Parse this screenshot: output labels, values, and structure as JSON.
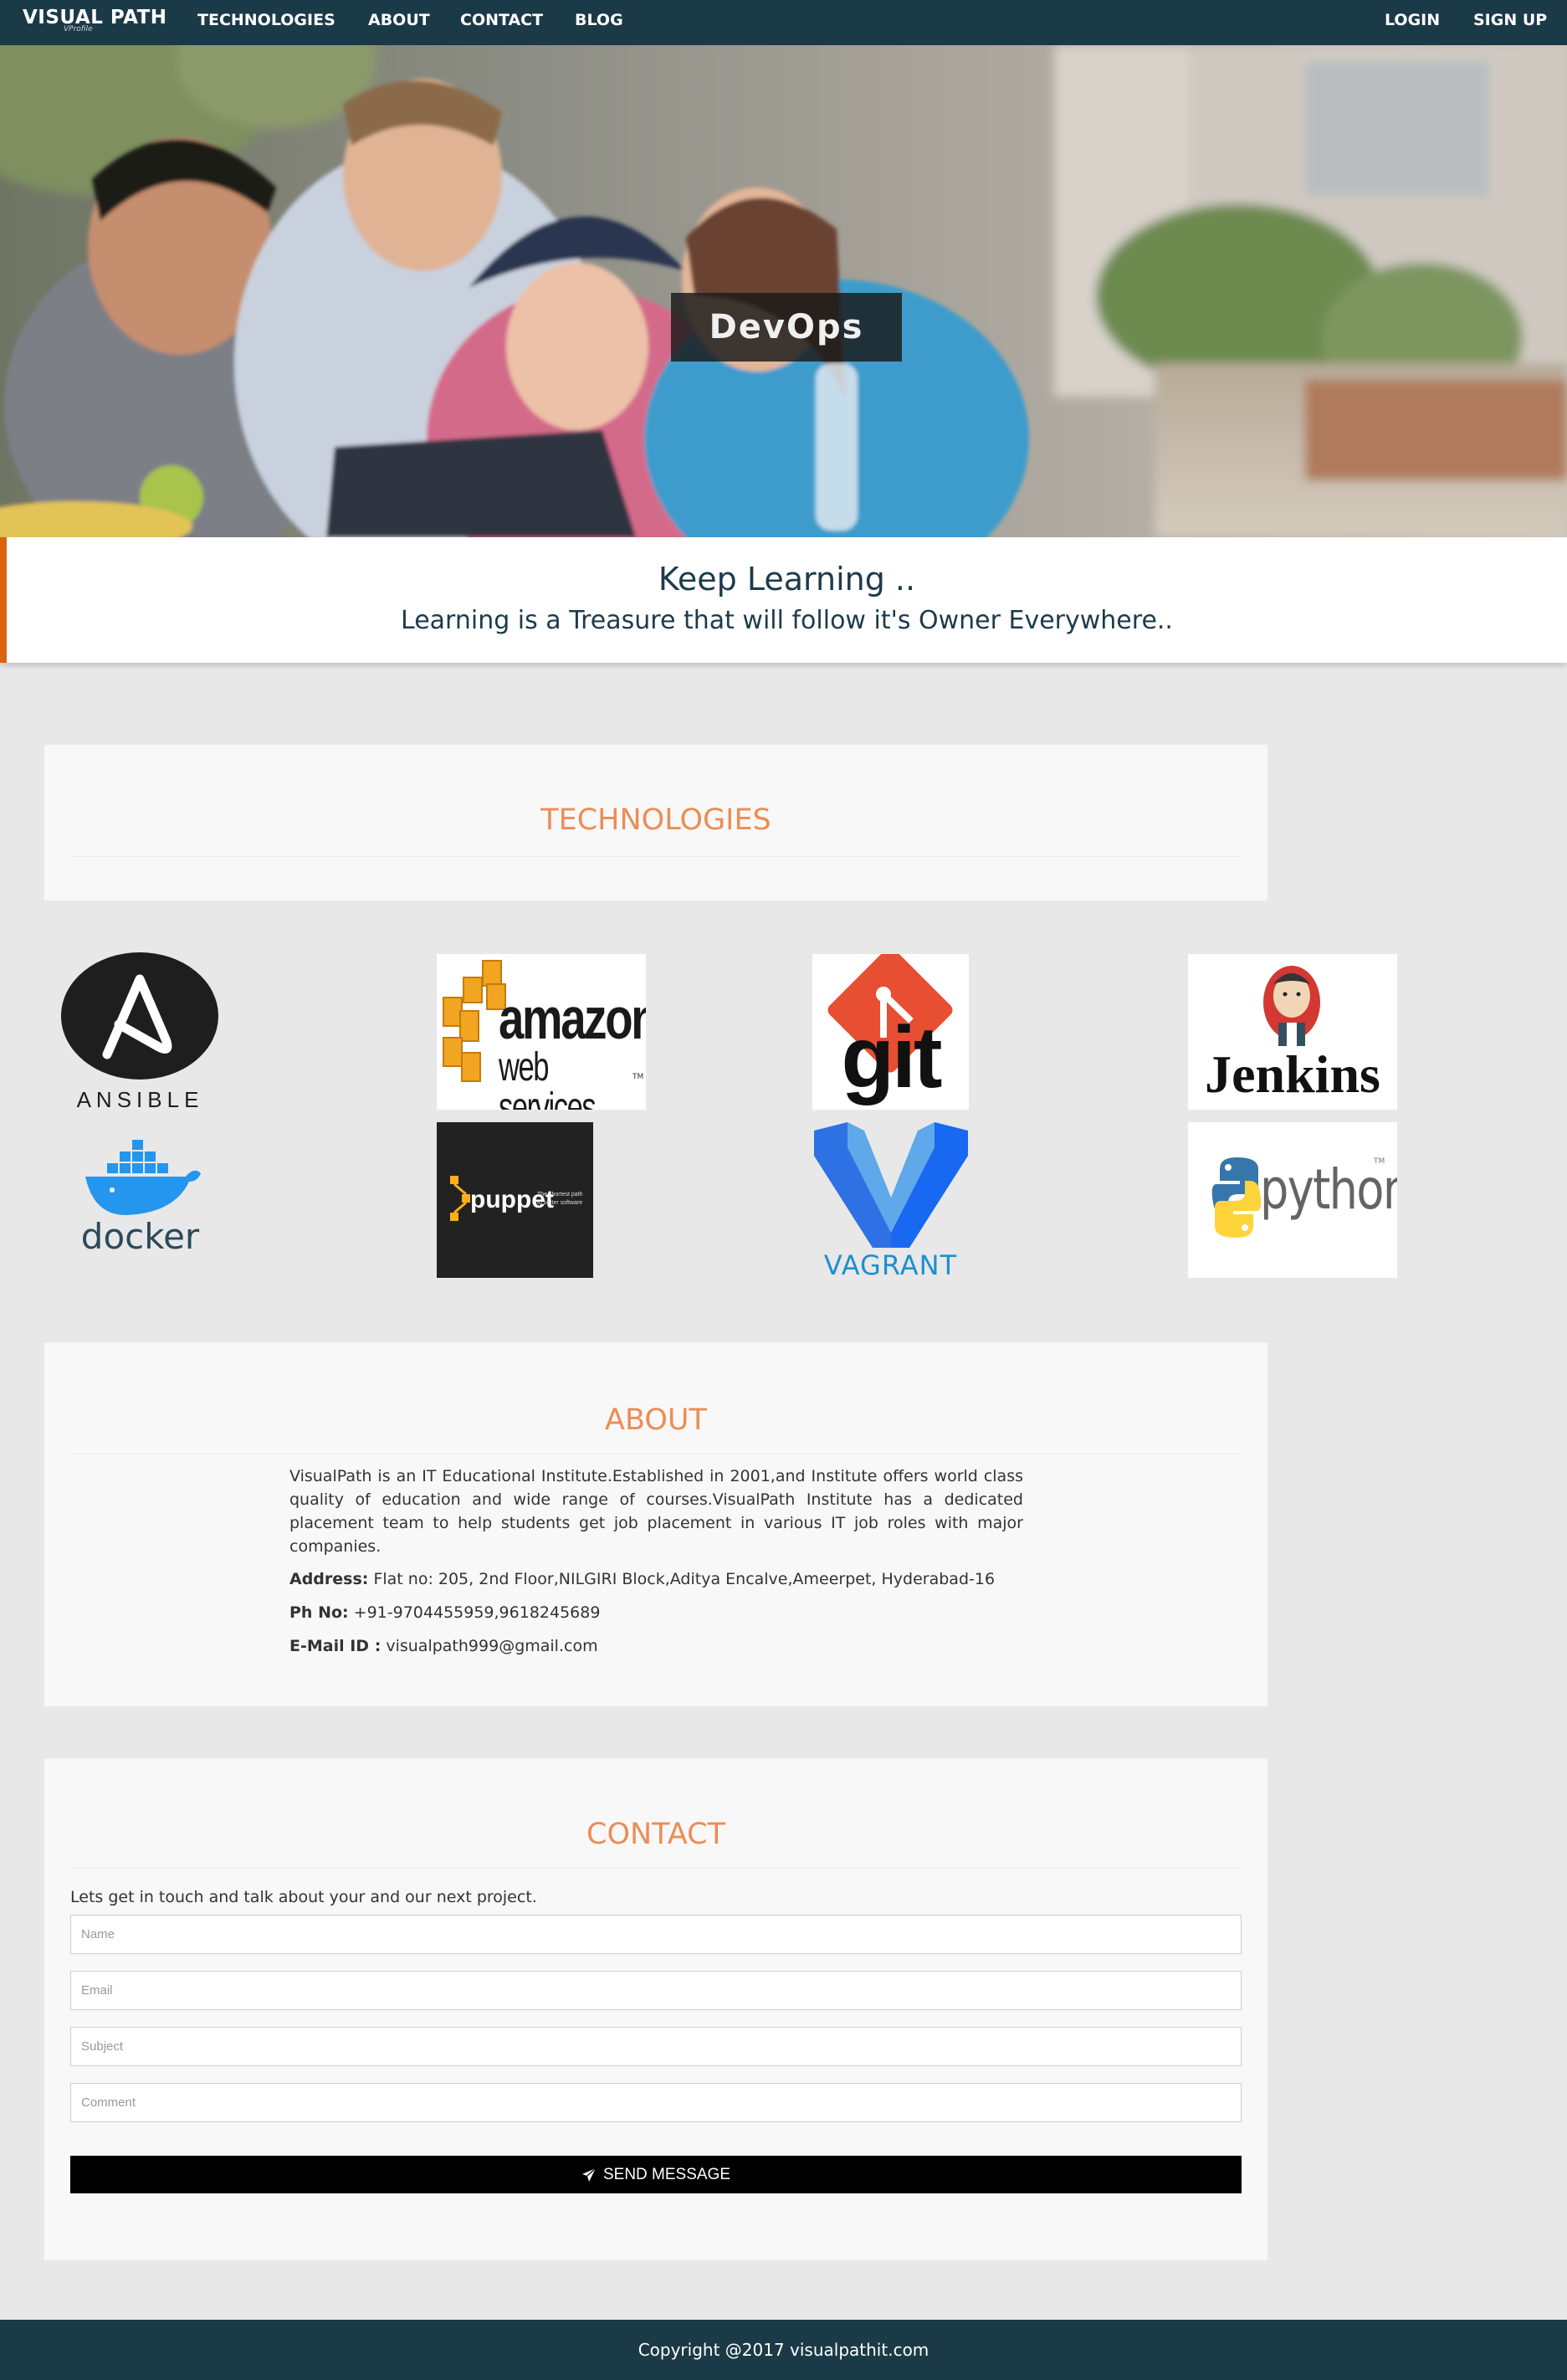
{
  "nav": {
    "brand": "VISUAL PATH",
    "brand_sub": "VProfile",
    "links": [
      "TECHNOLOGIES",
      "ABOUT",
      "CONTACT",
      "BLOG"
    ],
    "login": "LOGIN",
    "signup": "SIGN UP"
  },
  "hero": {
    "title": "DevOps"
  },
  "tagline": {
    "heading": "Keep Learning ..",
    "quote": "Learning is a Treasure that will follow it's Owner Everywhere.."
  },
  "technologies": {
    "title": "TECHNOLOGIES",
    "logos": [
      {
        "name": "ansible",
        "label": "ANSIBLE"
      },
      {
        "name": "aws",
        "label_1": "amazon",
        "label_2": "web services",
        "tm": "TM"
      },
      {
        "name": "git",
        "label": "git"
      },
      {
        "name": "jenkins",
        "label": "Jenkins"
      },
      {
        "name": "docker",
        "label": "docker"
      },
      {
        "name": "puppet",
        "label": "puppet",
        "tagline_1": "The shortest path",
        "tagline_2": "to better software"
      },
      {
        "name": "vagrant",
        "label": "VAGRANT"
      },
      {
        "name": "python",
        "label": "python",
        "tm": "TM"
      }
    ]
  },
  "about": {
    "title": "ABOUT",
    "description": "VisualPath is an IT Educational Institute.Established in 2001,and Institute offers world class quality of education and wide range of courses.VisualPath Institute has a dedicated placement team to help students get job placement in various IT job roles with major companies.",
    "address_label": "Address:",
    "address": "Flat no: 205, 2nd Floor,NILGIRI Block,Aditya Encalve,Ameerpet, Hyderabad-16",
    "phone_label": "Ph No:",
    "phone": "+91-9704455959,9618245689",
    "email_label": "E-Mail ID :",
    "email": "visualpath999@gmail.com"
  },
  "contact": {
    "title": "CONTACT",
    "intro": "Lets get in touch and talk about your and our next project.",
    "name_placeholder": "Name",
    "email_placeholder": "Email",
    "subject_placeholder": "Subject",
    "comment_placeholder": "Comment",
    "send_label": "SEND MESSAGE"
  },
  "footer": {
    "copyright": "Copyright @2017 visualpathit.com"
  },
  "colors": {
    "navbar": "#1b3a48",
    "accent_orange": "#ec8d54",
    "tagline_border": "#d9640f",
    "button": "#000000"
  }
}
